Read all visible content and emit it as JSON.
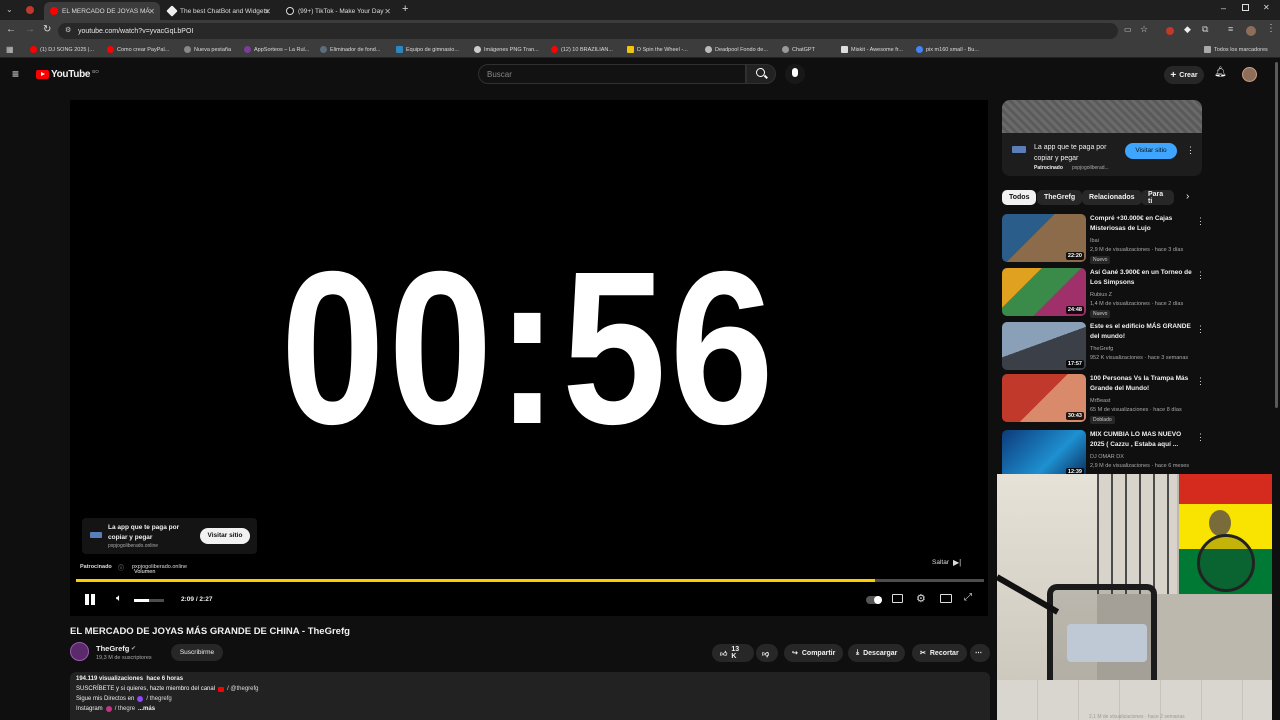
{
  "browser": {
    "tabs": [
      {
        "title": "EL MERCADO DE JOYAS MÁ",
        "active": true
      },
      {
        "title": "The best ChatBot and Widgets"
      },
      {
        "title": "(99+) TikTok - Make Your Day"
      }
    ],
    "url": "youtube.com/watch?v=yvacGqLbPOI",
    "bookmarks": [
      "(1) DJ SONG 2025 |...",
      "Como crear PayPal...",
      "Nueva pestaña",
      "AppSorteos – La Rul...",
      "Eliminador de fond...",
      "Equipo de gimnasio...",
      "Imágenes PNG Tran...",
      "(12) 10 BRAZILIAN...",
      "D Spin the Wheel -...",
      "Deadpool Fondo de...",
      "ChatGPT",
      "Miskit - Awesome fr...",
      "pix m160 small - Bu..."
    ],
    "all_bookmarks": "Todos los marcadores"
  },
  "youtube": {
    "logo": "YouTube",
    "country": "BO",
    "search_placeholder": "Buscar",
    "create_label": "Crear"
  },
  "player": {
    "timer": "00:56",
    "ad_title": "La app que te paga por copiar y pegar",
    "ad_domain": "pxpjogoliberado.online",
    "ad_visit": "Visitar sitio",
    "sponsored": "Patrocinado",
    "sponsored_domain": "pxpjogoliberado.online",
    "tooltip": "Volumen",
    "skip": "Saltar",
    "time": "2:09 / 2:27",
    "progress": 0.88,
    "volume": 0.5
  },
  "video": {
    "title": "EL MERCADO DE JOYAS MÁS GRANDE DE CHINA - TheGrefg",
    "channel": "TheGrefg",
    "subscribers": "19,3 M de suscriptores",
    "subscribe": "Suscribirme",
    "likes": "13 K",
    "share": "Compartir",
    "download": "Descargar",
    "clip": "Recortar",
    "views_line": "194.119 visualizaciones  hace 6 horas",
    "desc1": "SUSCRÍBETE y si quieres, hazte miembro del canal",
    "desc1_link": "/ @thegrefg",
    "desc2": "Sigue mis Directos en",
    "desc2_link": "/ thegrefg",
    "desc3": "Instagram",
    "desc3_link": "/ thegre",
    "more": "...más"
  },
  "sidebar": {
    "ad_title": "La app que te paga por copiar y pegar",
    "ad_sponsored": "Patrocinado",
    "ad_domain": "pxpjogoliberad...",
    "ad_visit": "Visitar sitio",
    "chips": [
      "Todos",
      "TheGrefg",
      "Relacionados",
      "Para ti"
    ],
    "videos": [
      {
        "title": "Compré +30.000€ en Cajas Misteriosas de Lujo",
        "channel": "Ibai",
        "meta": "2,9 M de visualizaciones · hace 3 días",
        "badge": "Nuevo",
        "duration": "22:20",
        "color": "#6b5a45"
      },
      {
        "title": "Así Gané 3.900€ en un Torneo de Los Simpsons",
        "channel": "Rubius Z",
        "meta": "1,4 M de visualizaciones · hace 2 días",
        "badge": "Nuevo",
        "duration": "24:48",
        "color": "#8a3a6a"
      },
      {
        "title": "Este es el edificio MÁS GRANDE del mundo!",
        "channel": "TheGrefg",
        "meta": "952 K visualizaciones · hace 3 semanas",
        "badge": "",
        "duration": "17:57",
        "color": "#4a4f5a"
      },
      {
        "title": "100 Personas Vs la Trampa Más Grande del Mundo!",
        "channel": "MrBeast",
        "meta": "65 M de visualizaciones · hace 8 días",
        "badge": "Doblado",
        "duration": "30:43",
        "color": "#a33a2e"
      },
      {
        "title": "MIX CUMBIA LO MAS NUEVO 2025 ( Cazzu , Estaba aquí ...",
        "channel": "DJ OMAR DX",
        "meta": "2,9 M de visualizaciones · hace 6 meses",
        "badge": "",
        "duration": "12:39",
        "color": "#1d4e8a"
      }
    ],
    "hidden_meta": "2,1 M de visualizaciones · hace 2 semanas"
  },
  "colors": {
    "accent": "#ff0000",
    "link": "#3ea6ff",
    "progress": "#ffcc00"
  }
}
